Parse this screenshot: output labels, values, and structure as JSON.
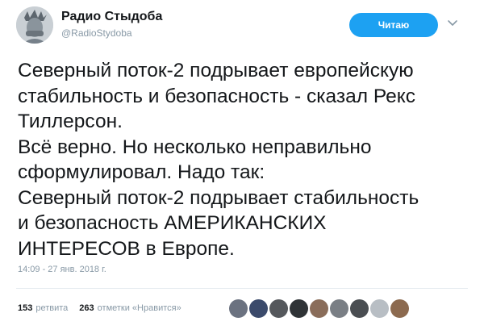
{
  "account": {
    "name": "Радио Стыдоба",
    "handle": "@RadioStydoba",
    "avatar": "statue-of-liberty-facepalm-avatar"
  },
  "actions": {
    "follow_label": "Читаю",
    "menu_icon": "chevron-down-icon"
  },
  "tweet": {
    "lines": [
      "Северный поток-2 подрывает европейскую",
      "стабильность и безопасность - сказал Рекс",
      "Тиллерсон.",
      "Всё верно. Но несколько неправильно",
      "сформулировал. Надо так:",
      "Северный поток-2 подрывает стабильность",
      "и безопасность АМЕРИКАНСКИХ",
      "ИНТЕРЕСОВ в Европе."
    ],
    "timestamp": "14:09 - 27 янв. 2018 г."
  },
  "stats": {
    "retweets_count": "153",
    "retweets_label": "ретвита",
    "likes_count": "263",
    "likes_label": "отметки «Нравится»"
  },
  "likers": [
    {
      "icon": "liker-avatar-1",
      "color": "#6b7280"
    },
    {
      "icon": "liker-avatar-2",
      "color": "#3b4a6b"
    },
    {
      "icon": "liker-avatar-3",
      "color": "#55585c"
    },
    {
      "icon": "liker-avatar-4",
      "color": "#2f3336"
    },
    {
      "icon": "liker-avatar-5",
      "color": "#8a6d5a"
    },
    {
      "icon": "liker-avatar-6",
      "color": "#7a7f85"
    },
    {
      "icon": "liker-avatar-7",
      "color": "#4a4e52"
    },
    {
      "icon": "liker-avatar-8",
      "color": "#b8bec4"
    },
    {
      "icon": "liker-avatar-9",
      "color": "#8c6a4f"
    }
  ],
  "colors": {
    "accent": "#1da1f2",
    "text": "#14171a",
    "muted": "#8899a6"
  }
}
